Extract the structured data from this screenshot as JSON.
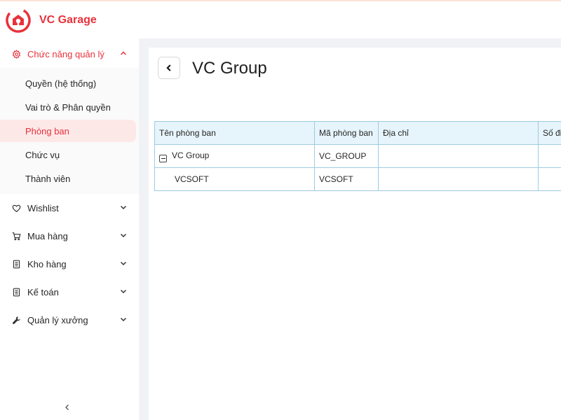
{
  "app": {
    "brand": "VC Garage",
    "accent_color": "#e8313b"
  },
  "sidebar": {
    "groups": [
      {
        "label": "Chức năng quản lý",
        "icon": "gear-icon",
        "open": true,
        "items": [
          {
            "label": "Quyền (hệ thống)"
          },
          {
            "label": "Vai trò & Phân quyền"
          },
          {
            "label": "Phòng ban",
            "active": true
          },
          {
            "label": "Chức vụ"
          },
          {
            "label": "Thành viên"
          }
        ]
      },
      {
        "label": "Wishlist",
        "icon": "heart-icon"
      },
      {
        "label": "Mua hàng",
        "icon": "cart-icon"
      },
      {
        "label": "Kho hàng",
        "icon": "ledger-icon"
      },
      {
        "label": "Kế toán",
        "icon": "ledger-icon"
      },
      {
        "label": "Quản lý xưởng",
        "icon": "wrench-icon"
      }
    ]
  },
  "page": {
    "title": "VC Group"
  },
  "table": {
    "columns": [
      "Tên phòng ban",
      "Mã phòng ban",
      "Địa chỉ",
      "Số đi"
    ],
    "rows": [
      {
        "name": "VC Group",
        "code": "VC_GROUP",
        "address": "",
        "extra": "",
        "expanded": true
      },
      {
        "name": "VCSOFT",
        "code": "VCSOFT",
        "address": "",
        "extra": ""
      }
    ]
  }
}
